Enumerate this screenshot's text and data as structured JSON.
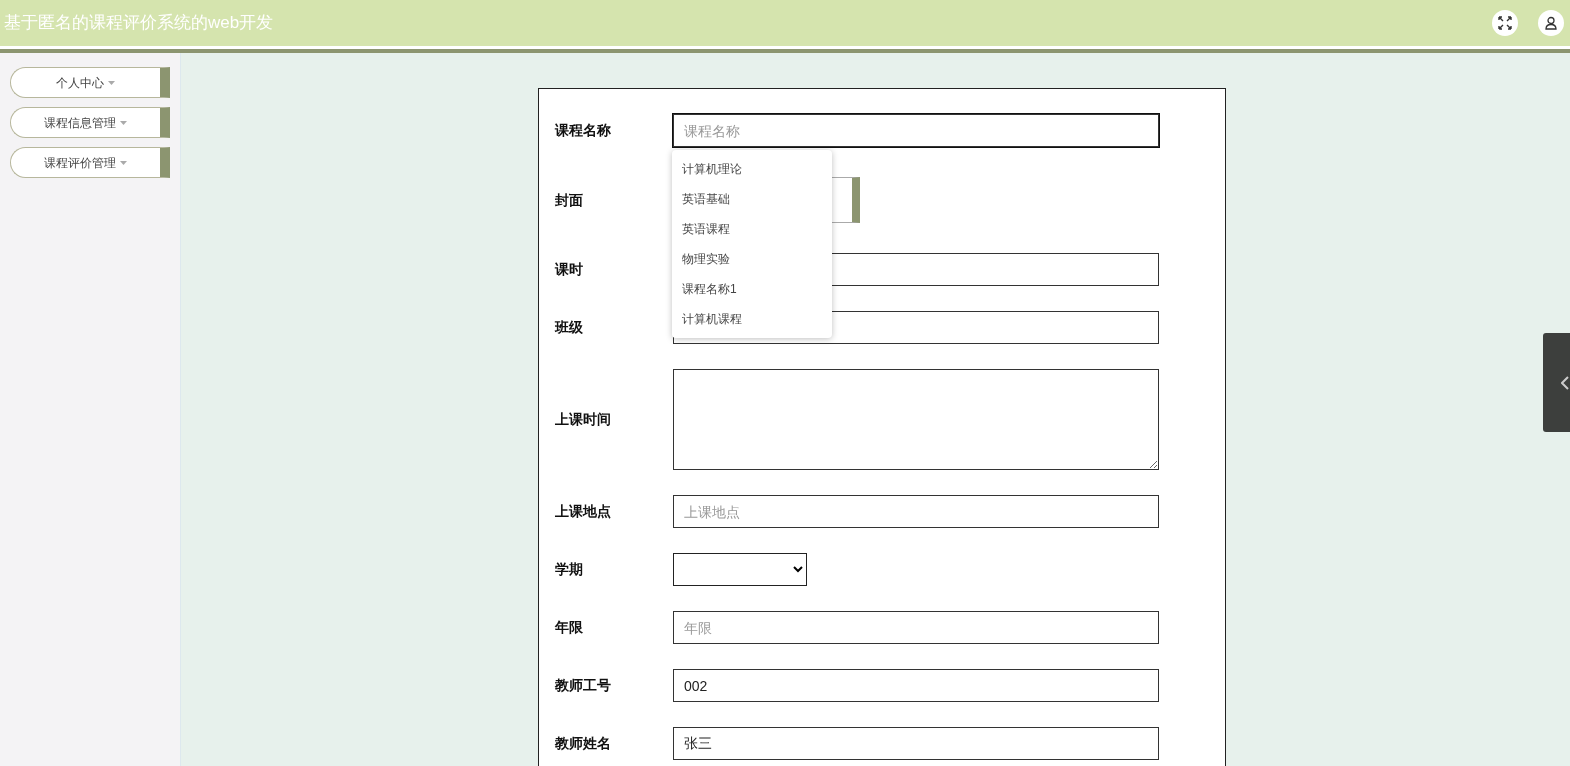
{
  "header": {
    "title": "基于匿名的课程评价系统的web开发"
  },
  "sidebar": {
    "items": [
      {
        "label": "个人中心"
      },
      {
        "label": "课程信息管理"
      },
      {
        "label": "课程评价管理"
      }
    ]
  },
  "form": {
    "fields": [
      {
        "kind": "text",
        "label": "课程名称",
        "placeholder": "课程名称",
        "focused": true,
        "suggestions": [
          "计算机理论",
          "英语基础",
          "英语课程",
          "物理实验",
          "课程名称1",
          "计算机课程"
        ]
      },
      {
        "kind": "upload",
        "label": "封面"
      },
      {
        "kind": "text",
        "label": "课时"
      },
      {
        "kind": "text",
        "label": "班级"
      },
      {
        "kind": "textarea",
        "label": "上课时间"
      },
      {
        "kind": "text",
        "label": "上课地点",
        "placeholder": "上课地点"
      },
      {
        "kind": "select",
        "label": "学期"
      },
      {
        "kind": "text",
        "label": "年限",
        "placeholder": "年限"
      },
      {
        "kind": "text",
        "label": "教师工号",
        "value": "002"
      },
      {
        "kind": "text",
        "label": "教师姓名",
        "value": "张三"
      }
    ]
  }
}
